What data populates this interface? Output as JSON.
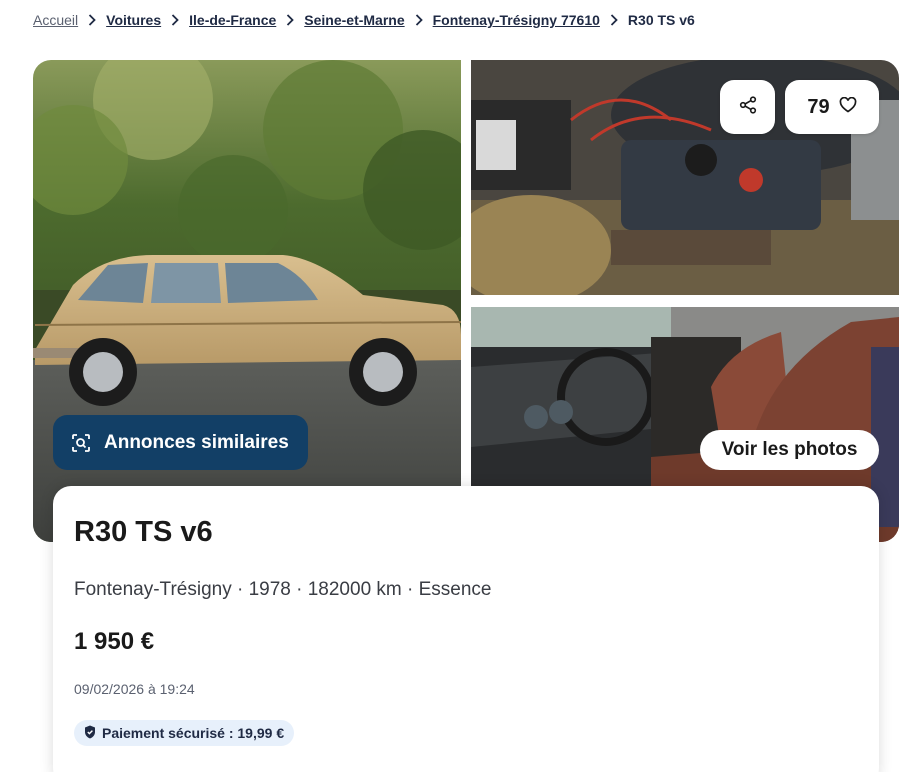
{
  "breadcrumb": {
    "items": [
      "Accueil",
      "Voitures",
      "Ile-de-France",
      "Seine-et-Marne",
      "Fontenay-Trésigny 77610"
    ],
    "current": "R30 TS v6"
  },
  "gallery": {
    "similar_button": "Annonces similaires",
    "favorites_count": "79",
    "see_photos_button": "Voir les photos",
    "icons": {
      "similar": "image-search-icon",
      "share": "share-icon",
      "favorite": "heart-icon",
      "breadcrumb_sep": "chevron-right-icon"
    }
  },
  "listing": {
    "title": "R30 TS v6",
    "subtitle": "Fontenay-Trésigny · 1978 · 182000 km · Essence",
    "price": "1 950 €",
    "date": "09/02/2026 à 19:24",
    "secure_payment": "Paiement sécurisé : 19,99 €"
  },
  "colors": {
    "primary": "#123f66",
    "badge_bg": "#e7f0fb",
    "text": "#1a1a1a"
  }
}
